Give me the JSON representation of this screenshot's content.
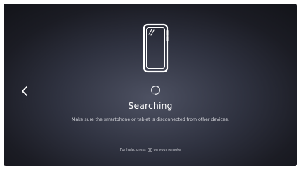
{
  "screen": {
    "title": "Searching",
    "message": "Make sure the smartphone or tablet is disconnected from other devices.",
    "help": {
      "prefix": "For help, press",
      "key_icon": "remote-menu-key-icon",
      "suffix": "on your remote"
    }
  },
  "icons": {
    "back": "chevron-left-icon",
    "device": "smartphone-icon",
    "status": "loading-spinner-icon"
  },
  "colors": {
    "background_center": "#4d5162",
    "background_edge": "#14151b",
    "text": "#ffffff",
    "secondary_text": "#d8d9de"
  }
}
